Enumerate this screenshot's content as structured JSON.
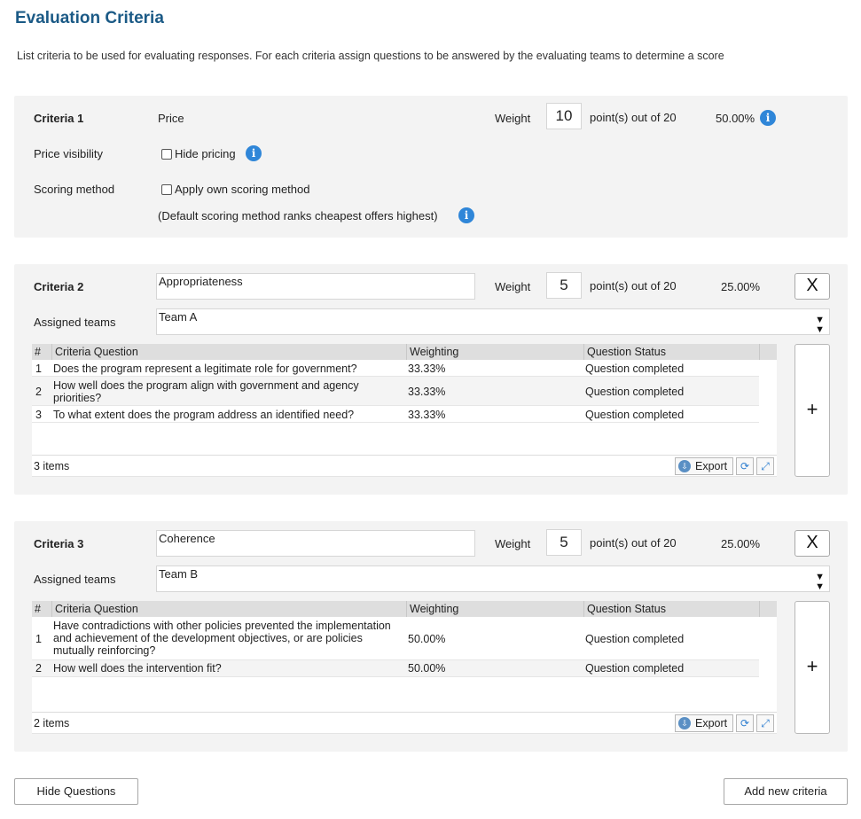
{
  "page": {
    "title": "Evaluation Criteria",
    "description": "List criteria to be used for evaluating responses. For each criteria assign questions to be answered by the evaluating teams to determine a score"
  },
  "criteria1": {
    "label": "Criteria 1",
    "name": "Price",
    "weight_label": "Weight",
    "weight": "10",
    "points_text": "point(s) out of 20",
    "percent": "50.00%",
    "price_visibility_label": "Price visibility",
    "hide_pricing_label": "Hide pricing",
    "hide_pricing_checked": false,
    "scoring_method_label": "Scoring method",
    "apply_own_scoring_label": "Apply own scoring method",
    "apply_own_scoring_checked": false,
    "default_scoring_note": "(Default scoring method ranks cheapest offers highest)"
  },
  "criteria2": {
    "label": "Criteria 2",
    "name": "Appropriateness",
    "weight_label": "Weight",
    "weight": "5",
    "points_text": "point(s) out of 20",
    "percent": "25.00%",
    "remove_label": "X",
    "teams_label": "Assigned teams",
    "teams_value": "Team A",
    "columns": [
      "#",
      "Criteria Question",
      "Weighting",
      "Question Status"
    ],
    "rows": [
      {
        "num": "1",
        "question": "Does the program represent a legitimate role for government?",
        "weighting": "33.33%",
        "status": "Question completed"
      },
      {
        "num": "2",
        "question": "How well does the program align with government and agency priorities?",
        "weighting": "33.33%",
        "status": "Question completed"
      },
      {
        "num": "3",
        "question": "To what extent does the program address an identified need?",
        "weighting": "33.33%",
        "status": "Question completed"
      }
    ],
    "item_count": "3 items",
    "export_label": "Export",
    "add_label": "+"
  },
  "criteria3": {
    "label": "Criteria 3",
    "name": "Coherence",
    "weight_label": "Weight",
    "weight": "5",
    "points_text": "point(s) out of 20",
    "percent": "25.00%",
    "remove_label": "X",
    "teams_label": "Assigned teams",
    "teams_value": "Team B",
    "columns": [
      "#",
      "Criteria Question",
      "Weighting",
      "Question Status"
    ],
    "rows": [
      {
        "num": "1",
        "question": "Have contradictions with other policies prevented the implementation and achievement of the development objectives, or are policies mutually reinforcing?",
        "weighting": "50.00%",
        "status": "Question completed"
      },
      {
        "num": "2",
        "question": "How well does the intervention fit?",
        "weighting": "50.00%",
        "status": "Question completed"
      }
    ],
    "item_count": "2 items",
    "export_label": "Export",
    "add_label": "+"
  },
  "buttons": {
    "hide_questions": "Hide Questions",
    "add_new_criteria": "Add new criteria"
  },
  "icons": {
    "info": "info-icon",
    "dropdown": "double-chevron-down-icon",
    "export": "download-icon",
    "refresh": "refresh-icon",
    "expand": "expand-icon"
  },
  "colors": {
    "title": "#1b5a86",
    "info": "#2f86d8",
    "panel": "#f3f3f3",
    "grid_header": "#dedede"
  }
}
